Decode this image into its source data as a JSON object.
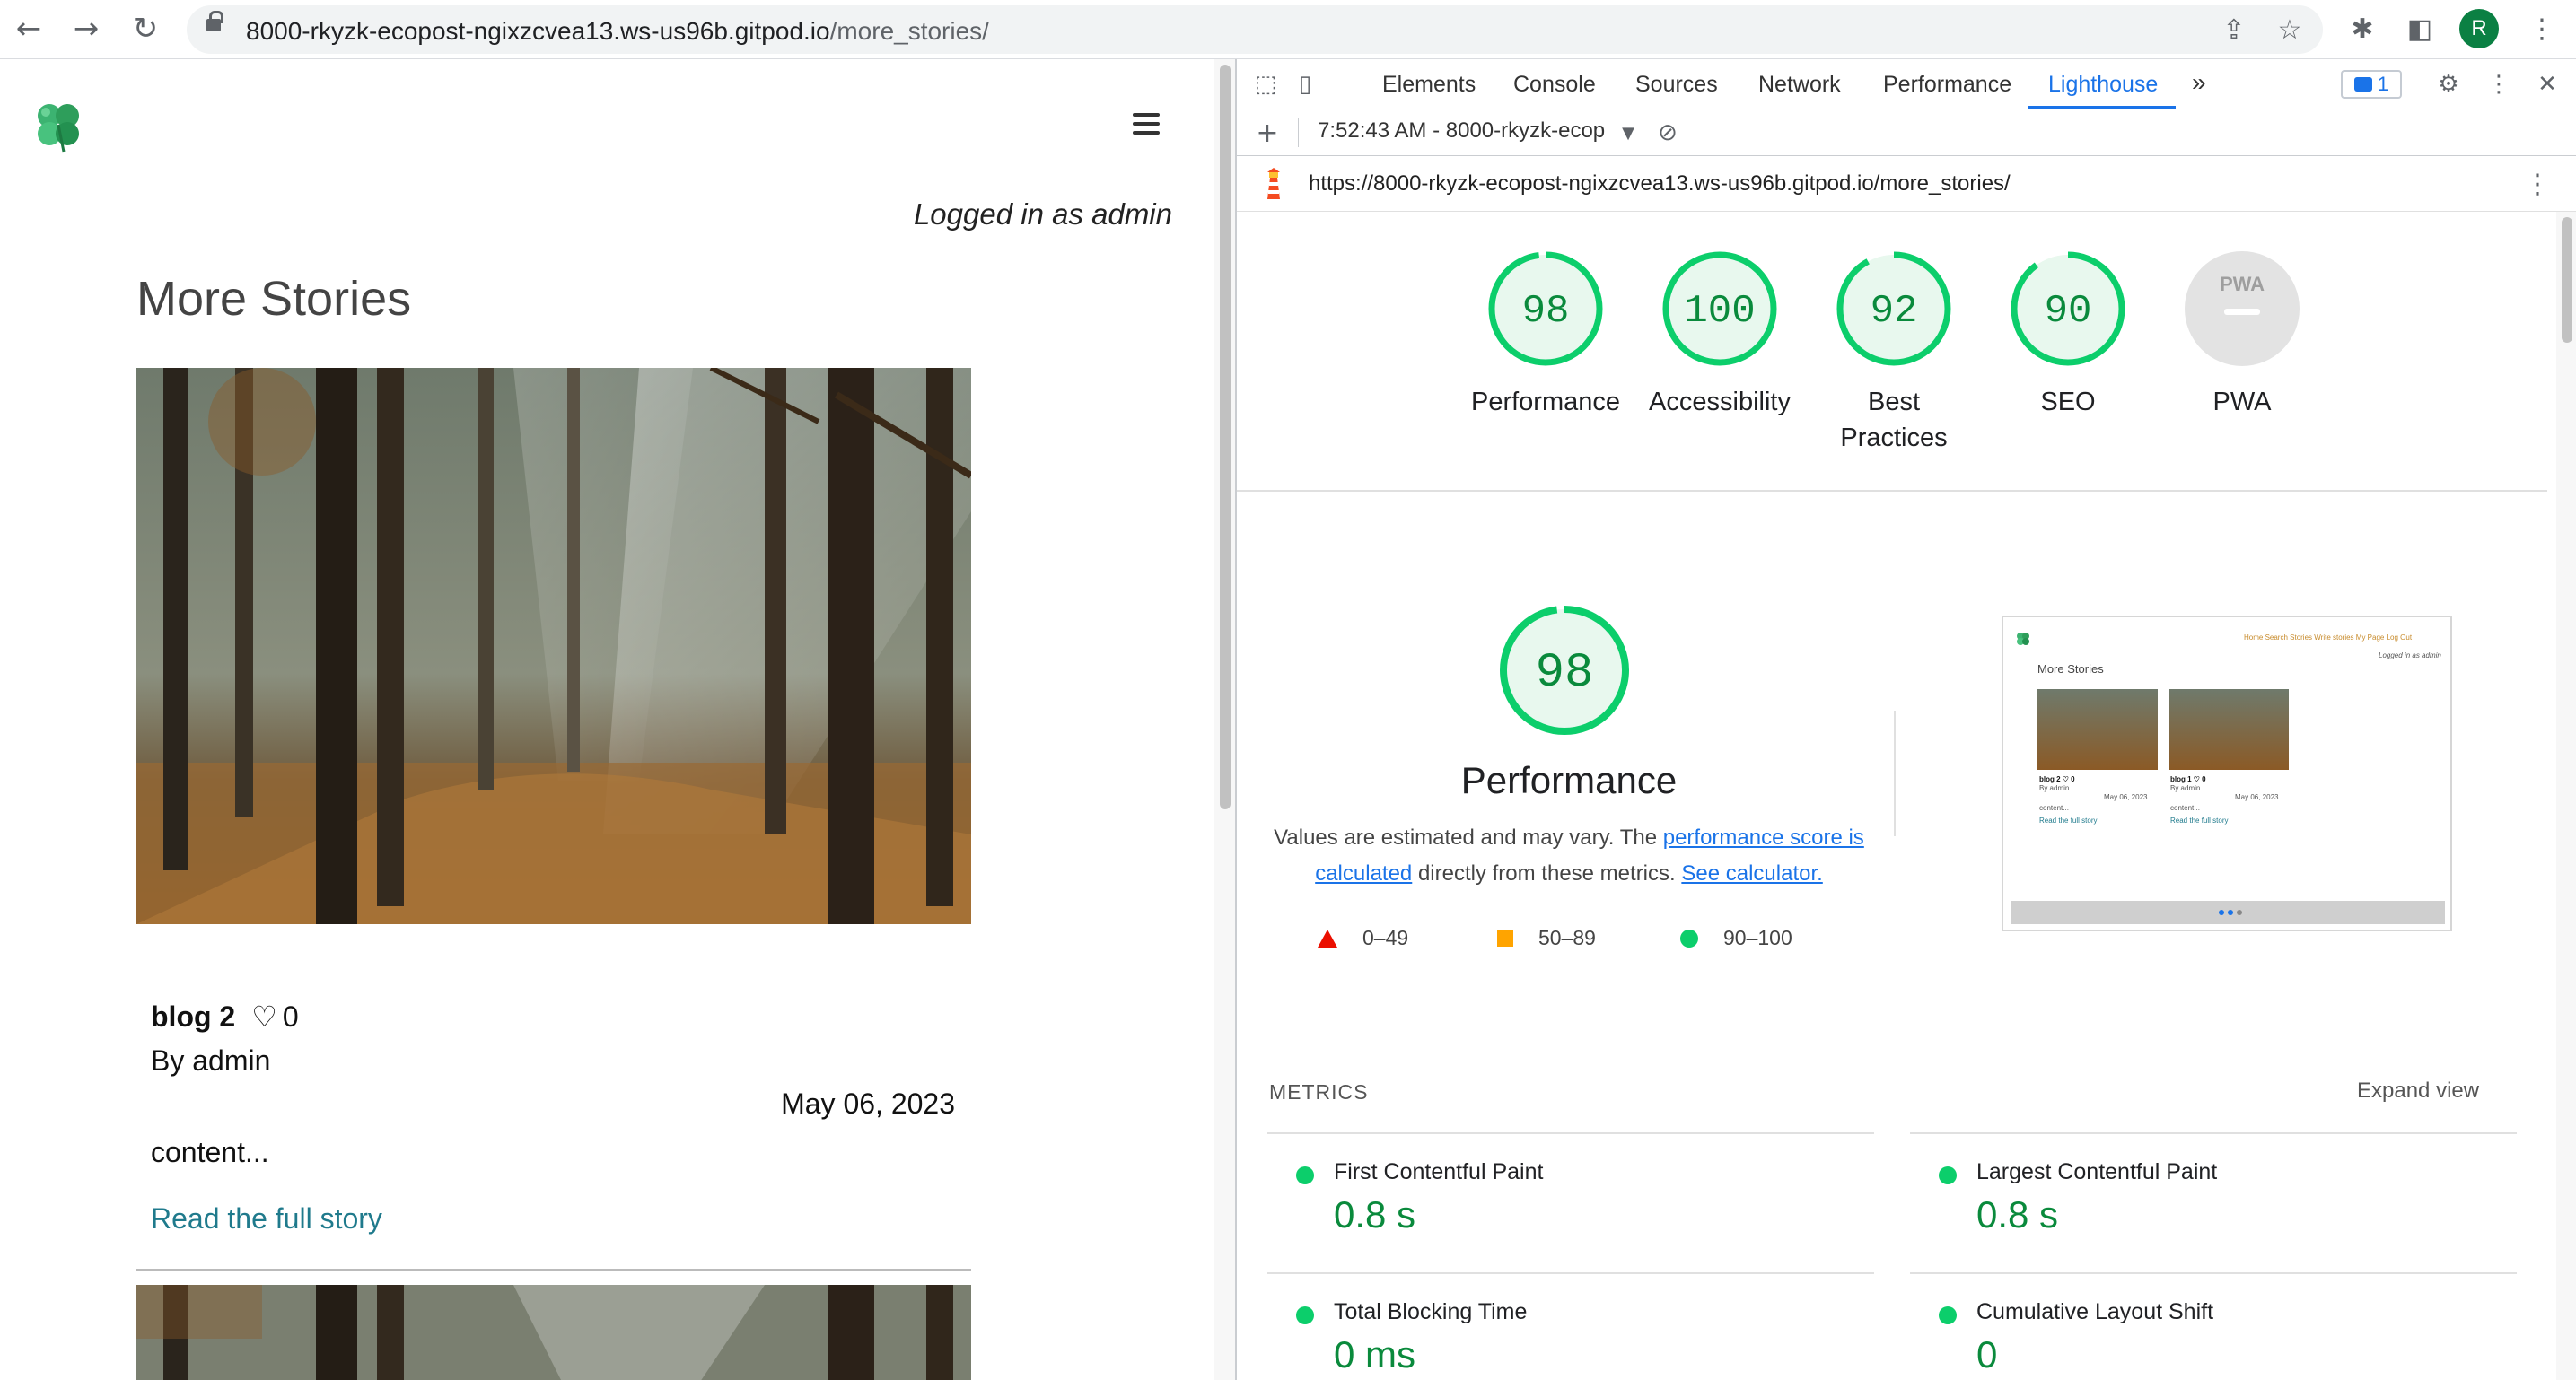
{
  "browser": {
    "url_host": "8000-rkyzk-ecopost-ngixzcvea13.ws-us96b.gitpod.io",
    "url_path": "/more_stories/",
    "profile_initial": "R"
  },
  "page": {
    "logged_in_text": "Logged in as admin",
    "heading": "More Stories",
    "card": {
      "title": "blog 2",
      "likes": "0",
      "author": "By admin",
      "date": "May 06, 2023",
      "excerpt": "content...",
      "read_more": "Read the full story"
    }
  },
  "devtools": {
    "tabs": [
      "Elements",
      "Console",
      "Sources",
      "Network",
      "Performance",
      "Lighthouse"
    ],
    "active_tab": "Lighthouse",
    "more_tabs": "»",
    "issues_count": "1",
    "report_select": "7:52:43 AM - 8000-rkyzk-ecop",
    "report_url": "https://8000-rkyzk-ecopost-ngixzcvea13.ws-us96b.gitpod.io/more_stories/"
  },
  "lighthouse": {
    "scores": [
      {
        "label": "Performance",
        "score": "98"
      },
      {
        "label": "Accessibility",
        "score": "100"
      },
      {
        "label": "Best Practices",
        "score": "92"
      },
      {
        "label": "SEO",
        "score": "90"
      },
      {
        "label": "PWA",
        "score": ""
      }
    ],
    "pwa_badge": "PWA",
    "performance": {
      "score": "98",
      "title": "Performance",
      "desc_prefix": "Values are estimated and may vary. The ",
      "desc_link": "performance score is calculated",
      "desc_middle": " directly from these metrics. ",
      "desc_link2": "See calculator.",
      "legend": [
        "0–49",
        "50–89",
        "90–100"
      ]
    },
    "thumbnail": {
      "nav": "Home  Search Stories  Write stories  My Page  Log Out",
      "logged": "Logged in as admin",
      "heading": "More Stories",
      "card1_title": "blog 2  ♡ 0",
      "card2_title": "blog 1  ♡ 0",
      "by": "By admin",
      "date": "May 06, 2023",
      "content": "content...",
      "read": "Read the full story"
    },
    "metrics_header": "METRICS",
    "expand_view": "Expand view",
    "metrics": [
      {
        "name": "First Contentful Paint",
        "value": "0.8 s"
      },
      {
        "name": "Largest Contentful Paint",
        "value": "0.8 s"
      },
      {
        "name": "Total Blocking Time",
        "value": "0 ms"
      },
      {
        "name": "Cumulative Layout Shift",
        "value": "0"
      }
    ]
  },
  "colors": {
    "pass": "#0cce6b",
    "pass_text": "#0a8a3c",
    "average": "#ffa400",
    "fail": "#eb0f00",
    "link": "#1a73e8"
  }
}
